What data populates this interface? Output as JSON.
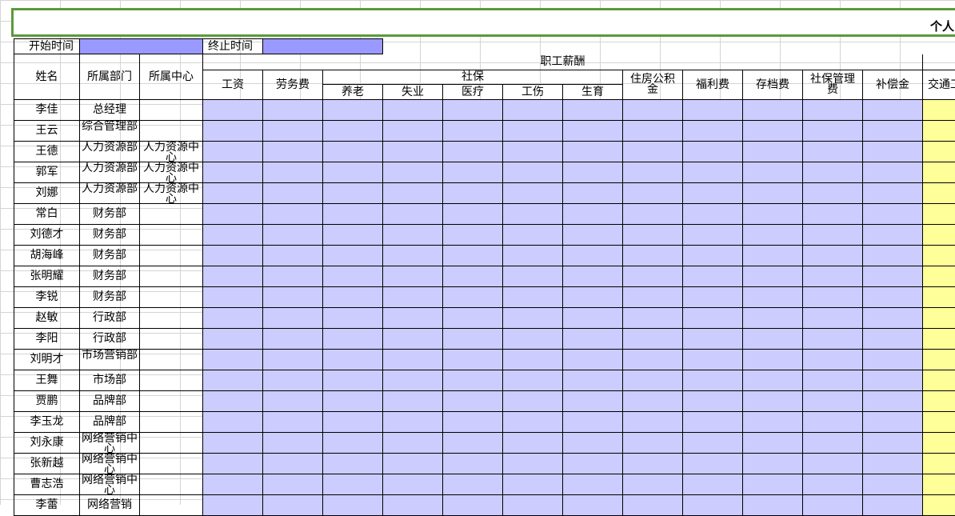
{
  "sheet": {
    "title_fragment": "个人",
    "start_label": "开始时间",
    "end_label": "终止时间",
    "start_value": "",
    "end_value": ""
  },
  "headers": {
    "name": "姓名",
    "dept": "所属部门",
    "center": "所属中心",
    "salary_group": "职工薪酬",
    "wage": "工资",
    "labor": "劳务费",
    "social_group": "社保",
    "pension": "养老",
    "unemployment": "失业",
    "medical": "医疗",
    "injury": "工伤",
    "maternity": "生育",
    "housing": "住房公积金",
    "welfare": "福利费",
    "archive": "存档费",
    "social_mgmt": "社保管理费",
    "compensation": "补偿金",
    "transport": "交通工费"
  },
  "employees": [
    {
      "name": "李佳",
      "dept": "总经理",
      "center": ""
    },
    {
      "name": "王云",
      "dept": "综合管理部",
      "center": ""
    },
    {
      "name": "王德",
      "dept": "人力资源部",
      "center": "人力资源中心"
    },
    {
      "name": "郭军",
      "dept": "人力资源部",
      "center": "人力资源中心"
    },
    {
      "name": "刘娜",
      "dept": "人力资源部",
      "center": "人力资源中心"
    },
    {
      "name": "常白",
      "dept": "财务部",
      "center": ""
    },
    {
      "name": "刘德才",
      "dept": "财务部",
      "center": ""
    },
    {
      "name": "胡海峰",
      "dept": "财务部",
      "center": ""
    },
    {
      "name": "张明耀",
      "dept": "财务部",
      "center": ""
    },
    {
      "name": "李锐",
      "dept": "财务部",
      "center": ""
    },
    {
      "name": "赵敏",
      "dept": "行政部",
      "center": ""
    },
    {
      "name": "李阳",
      "dept": "行政部",
      "center": ""
    },
    {
      "name": "刘明才",
      "dept": "市场营销部",
      "center": ""
    },
    {
      "name": "王舞",
      "dept": "市场部",
      "center": ""
    },
    {
      "name": "贾鹏",
      "dept": "品牌部",
      "center": ""
    },
    {
      "name": "李玉龙",
      "dept": "品牌部",
      "center": ""
    },
    {
      "name": "刘永康",
      "dept": "网络营销中心",
      "center": ""
    },
    {
      "name": "张新越",
      "dept": "网络营销中心",
      "center": ""
    },
    {
      "name": "曹志浩",
      "dept": "网络营销中心",
      "center": ""
    },
    {
      "name": "李蕾",
      "dept": "网络营销",
      "center": ""
    }
  ]
}
